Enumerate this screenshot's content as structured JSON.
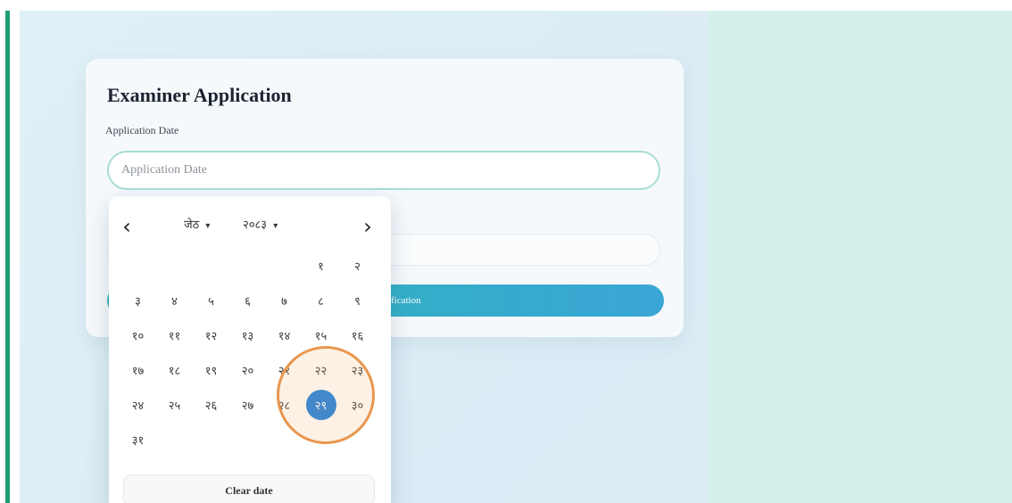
{
  "form": {
    "title": "Examiner Application",
    "date_label": "Application Date",
    "date_placeholder": "Application Date",
    "submit_label": "fication"
  },
  "calendar": {
    "prev_icon": "chevron-left-icon",
    "next_icon": "chevron-right-icon",
    "month": "जेठ",
    "year": "२०८३",
    "selected_day": "२९",
    "weeks": [
      [
        "",
        "",
        "",
        "",
        "",
        "१",
        "२"
      ],
      [
        "३",
        "४",
        "५",
        "६",
        "७",
        "८",
        "९"
      ],
      [
        "१०",
        "११",
        "१२",
        "१३",
        "१४",
        "१५",
        "१६"
      ],
      [
        "१७",
        "१८",
        "१९",
        "२०",
        "२१",
        "२२",
        "२३"
      ],
      [
        "२४",
        "२५",
        "२६",
        "२७",
        "२८",
        "२९",
        "३०"
      ],
      [
        "३१",
        "",
        "",
        "",
        "",
        "",
        ""
      ]
    ],
    "clear_label": "Clear date"
  },
  "colors": {
    "accent": "#1b7fe0",
    "highlight_ring": "#e9964e",
    "left_bar": "#1f9d74"
  }
}
